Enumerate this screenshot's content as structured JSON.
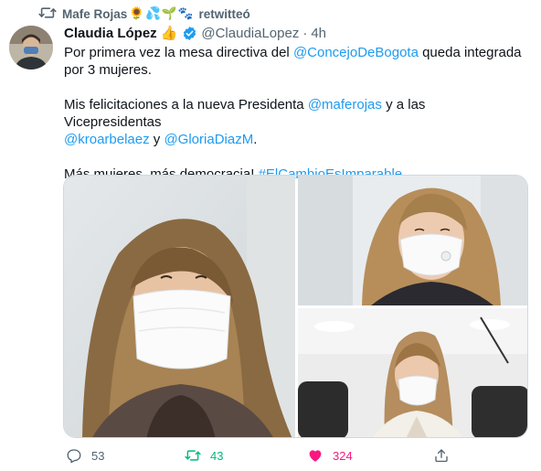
{
  "retweet_context": {
    "name": "Mafe Rojas",
    "emojis": "🌻💦🌱🐾",
    "suffix": "retwitteó"
  },
  "tweet": {
    "author_name": "Claudia López",
    "author_emoji": "👍",
    "handle": "@ClaudiaLopez",
    "separator": "·",
    "time": "4h",
    "line1_before": "Por primera vez la mesa directiva del ",
    "line1_mention": "@ConcejoDeBogota",
    "line1_after": " queda integrada",
    "line2": "por 3 mujeres.",
    "line3_before": "Mis felicitaciones a la nueva Presidenta ",
    "line3_mention": "@maferojas",
    "line3_after": " y a las Vicepresidentas",
    "line4_mention1": "@kroarbelaez",
    "line4_mid": " y ",
    "line4_mention2": "@GloriaDiazM",
    "line4_after": ".",
    "line5_before": "Más mujeres, más democracia! ",
    "line5_hashtag": "#ElCambioEsImparable"
  },
  "actions": {
    "replies": "53",
    "retweets": "43",
    "likes": "324"
  },
  "colors": {
    "link": "#1d9bf0",
    "retweet_green": "#00ba7c",
    "like_pink": "#f91880",
    "muted": "#536471"
  }
}
